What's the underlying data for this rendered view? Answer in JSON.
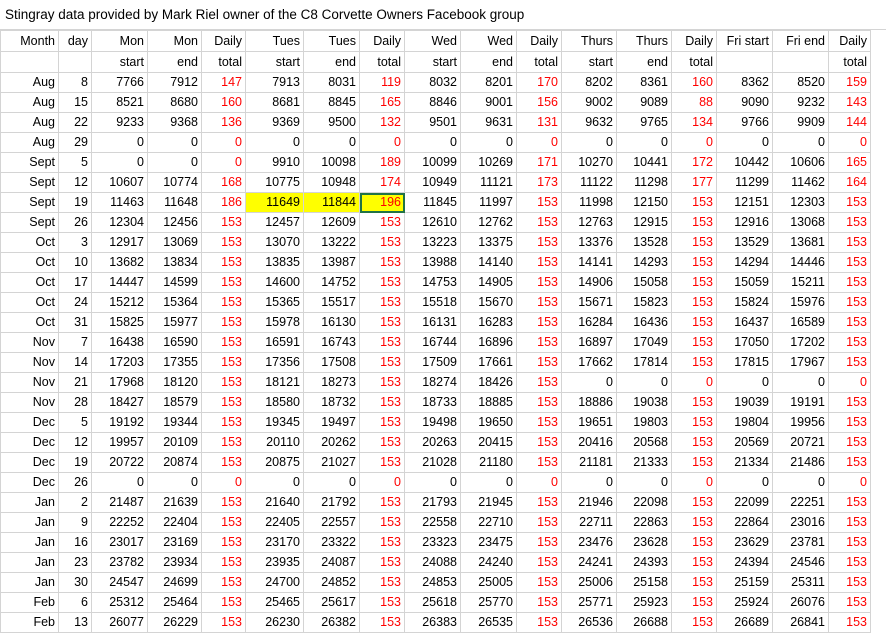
{
  "title": "Stingray data provided by Mark Riel owner of the C8 Corvette Owners Facebook group",
  "header_row1": [
    "Month",
    "day",
    "Mon",
    "Mon",
    "Daily",
    "Tues",
    "Tues",
    "Daily",
    "Wed",
    "Wed",
    "Daily",
    "Thurs",
    "Thurs",
    "Daily",
    "Fri start",
    "Fri end",
    "Daily"
  ],
  "header_row2": [
    "",
    "",
    "start",
    "end",
    "total",
    "start",
    "end",
    "total",
    "start",
    "end",
    "total",
    "start",
    "end",
    "total",
    "",
    "",
    "total"
  ],
  "rows": [
    [
      "Aug",
      "8",
      "7766",
      "7912",
      "147",
      "7913",
      "8031",
      "119",
      "8032",
      "8201",
      "170",
      "8202",
      "8361",
      "160",
      "8362",
      "8520",
      "159"
    ],
    [
      "Aug",
      "15",
      "8521",
      "8680",
      "160",
      "8681",
      "8845",
      "165",
      "8846",
      "9001",
      "156",
      "9002",
      "9089",
      "88",
      "9090",
      "9232",
      "143"
    ],
    [
      "Aug",
      "22",
      "9233",
      "9368",
      "136",
      "9369",
      "9500",
      "132",
      "9501",
      "9631",
      "131",
      "9632",
      "9765",
      "134",
      "9766",
      "9909",
      "144"
    ],
    [
      "Aug",
      "29",
      "0",
      "0",
      "0",
      "0",
      "0",
      "0",
      "0",
      "0",
      "0",
      "0",
      "0",
      "0",
      "0",
      "0",
      "0"
    ],
    [
      "Sept",
      "5",
      "0",
      "0",
      "0",
      "9910",
      "10098",
      "189",
      "10099",
      "10269",
      "171",
      "10270",
      "10441",
      "172",
      "10442",
      "10606",
      "165"
    ],
    [
      "Sept",
      "12",
      "10607",
      "10774",
      "168",
      "10775",
      "10948",
      "174",
      "10949",
      "11121",
      "173",
      "11122",
      "11298",
      "177",
      "11299",
      "11462",
      "164"
    ],
    [
      "Sept",
      "19",
      "11463",
      "11648",
      "186",
      "11649",
      "11844",
      "196",
      "11845",
      "11997",
      "153",
      "11998",
      "12150",
      "153",
      "12151",
      "12303",
      "153"
    ],
    [
      "Sept",
      "26",
      "12304",
      "12456",
      "153",
      "12457",
      "12609",
      "153",
      "12610",
      "12762",
      "153",
      "12763",
      "12915",
      "153",
      "12916",
      "13068",
      "153"
    ],
    [
      "Oct",
      "3",
      "12917",
      "13069",
      "153",
      "13070",
      "13222",
      "153",
      "13223",
      "13375",
      "153",
      "13376",
      "13528",
      "153",
      "13529",
      "13681",
      "153"
    ],
    [
      "Oct",
      "10",
      "13682",
      "13834",
      "153",
      "13835",
      "13987",
      "153",
      "13988",
      "14140",
      "153",
      "14141",
      "14293",
      "153",
      "14294",
      "14446",
      "153"
    ],
    [
      "Oct",
      "17",
      "14447",
      "14599",
      "153",
      "14600",
      "14752",
      "153",
      "14753",
      "14905",
      "153",
      "14906",
      "15058",
      "153",
      "15059",
      "15211",
      "153"
    ],
    [
      "Oct",
      "24",
      "15212",
      "15364",
      "153",
      "15365",
      "15517",
      "153",
      "15518",
      "15670",
      "153",
      "15671",
      "15823",
      "153",
      "15824",
      "15976",
      "153"
    ],
    [
      "Oct",
      "31",
      "15825",
      "15977",
      "153",
      "15978",
      "16130",
      "153",
      "16131",
      "16283",
      "153",
      "16284",
      "16436",
      "153",
      "16437",
      "16589",
      "153"
    ],
    [
      "Nov",
      "7",
      "16438",
      "16590",
      "153",
      "16591",
      "16743",
      "153",
      "16744",
      "16896",
      "153",
      "16897",
      "17049",
      "153",
      "17050",
      "17202",
      "153"
    ],
    [
      "Nov",
      "14",
      "17203",
      "17355",
      "153",
      "17356",
      "17508",
      "153",
      "17509",
      "17661",
      "153",
      "17662",
      "17814",
      "153",
      "17815",
      "17967",
      "153"
    ],
    [
      "Nov",
      "21",
      "17968",
      "18120",
      "153",
      "18121",
      "18273",
      "153",
      "18274",
      "18426",
      "153",
      "0",
      "0",
      "0",
      "0",
      "0",
      "0"
    ],
    [
      "Nov",
      "28",
      "18427",
      "18579",
      "153",
      "18580",
      "18732",
      "153",
      "18733",
      "18885",
      "153",
      "18886",
      "19038",
      "153",
      "19039",
      "19191",
      "153"
    ],
    [
      "Dec",
      "5",
      "19192",
      "19344",
      "153",
      "19345",
      "19497",
      "153",
      "19498",
      "19650",
      "153",
      "19651",
      "19803",
      "153",
      "19804",
      "19956",
      "153"
    ],
    [
      "Dec",
      "12",
      "19957",
      "20109",
      "153",
      "20110",
      "20262",
      "153",
      "20263",
      "20415",
      "153",
      "20416",
      "20568",
      "153",
      "20569",
      "20721",
      "153"
    ],
    [
      "Dec",
      "19",
      "20722",
      "20874",
      "153",
      "20875",
      "21027",
      "153",
      "21028",
      "21180",
      "153",
      "21181",
      "21333",
      "153",
      "21334",
      "21486",
      "153"
    ],
    [
      "Dec",
      "26",
      "0",
      "0",
      "0",
      "0",
      "0",
      "0",
      "0",
      "0",
      "0",
      "0",
      "0",
      "0",
      "0",
      "0",
      "0"
    ],
    [
      "Jan",
      "2",
      "21487",
      "21639",
      "153",
      "21640",
      "21792",
      "153",
      "21793",
      "21945",
      "153",
      "21946",
      "22098",
      "153",
      "22099",
      "22251",
      "153"
    ],
    [
      "Jan",
      "9",
      "22252",
      "22404",
      "153",
      "22405",
      "22557",
      "153",
      "22558",
      "22710",
      "153",
      "22711",
      "22863",
      "153",
      "22864",
      "23016",
      "153"
    ],
    [
      "Jan",
      "16",
      "23017",
      "23169",
      "153",
      "23170",
      "23322",
      "153",
      "23323",
      "23475",
      "153",
      "23476",
      "23628",
      "153",
      "23629",
      "23781",
      "153"
    ],
    [
      "Jan",
      "23",
      "23782",
      "23934",
      "153",
      "23935",
      "24087",
      "153",
      "24088",
      "24240",
      "153",
      "24241",
      "24393",
      "153",
      "24394",
      "24546",
      "153"
    ],
    [
      "Jan",
      "30",
      "24547",
      "24699",
      "153",
      "24700",
      "24852",
      "153",
      "24853",
      "25005",
      "153",
      "25006",
      "25158",
      "153",
      "25159",
      "25311",
      "153"
    ],
    [
      "Feb",
      "6",
      "25312",
      "25464",
      "153",
      "25465",
      "25617",
      "153",
      "25618",
      "25770",
      "153",
      "25771",
      "25923",
      "153",
      "25924",
      "26076",
      "153"
    ],
    [
      "Feb",
      "13",
      "26077",
      "26229",
      "153",
      "26230",
      "26382",
      "153",
      "26383",
      "26535",
      "153",
      "26536",
      "26688",
      "153",
      "26689",
      "26841",
      "153"
    ]
  ],
  "daily_total_color": "#ff0000",
  "highlight_color": "#ffff00",
  "highlighted_cells": [
    [
      6,
      5
    ],
    [
      6,
      6
    ],
    [
      6,
      7
    ]
  ],
  "selected_cell": [
    6,
    7
  ]
}
